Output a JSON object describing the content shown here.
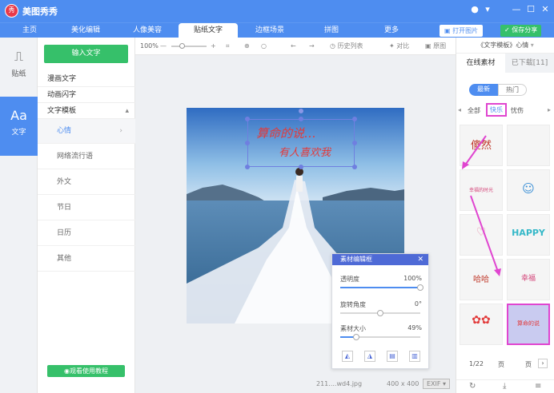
{
  "app": {
    "logo_glyph": "秀",
    "title": "美图秀秀"
  },
  "window": {
    "skin_icon": "chat-icon",
    "menu_icon": "dropdown-icon"
  },
  "nav": {
    "tabs": [
      "主页",
      "美化编辑",
      "人像美容",
      "贴纸文字",
      "边框场景",
      "拼图",
      "更多"
    ],
    "active_tab": "贴纸文字",
    "open_label": "打开图片",
    "save_label": "保存分享"
  },
  "iconbar": {
    "sticker_label": "贴纸",
    "text_label": "文字",
    "text_glyph": "Aa"
  },
  "categories": {
    "input_button": "输入文字",
    "head_items": [
      "漫画文字",
      "动画闪字",
      "文字模板"
    ],
    "sub_items": [
      "心情",
      "网络流行语",
      "外文",
      "节日",
      "日历",
      "其他"
    ],
    "active_sub": "心情",
    "tutorial_button": "观看使用教程"
  },
  "toolbar": {
    "zoom": "100%",
    "history": "历史列表",
    "compare": "对比",
    "original": "原图"
  },
  "canvas": {
    "sticker_line1": "算命的说…",
    "sticker_line2": "有人喜欢我"
  },
  "edit_panel": {
    "title": "素材编辑框",
    "opacity_label": "透明度",
    "opacity_value": "100%",
    "opacity_level": 1.0,
    "rotation_label": "旋转角度",
    "rotation_value": "0°",
    "rotation_level": 0.5,
    "size_label": "素材大小",
    "size_value": "49%",
    "size_level": 0.2
  },
  "status": {
    "filename": "211....wd4.jpg",
    "dimensions": "400 x 400",
    "exif": "EXIF"
  },
  "right_panel": {
    "title": "《文字模板》心情",
    "tab_online": "在线素材",
    "tab_downloaded": "已下载[11]",
    "toggle_new": "最新",
    "toggle_hot": "热门",
    "filters": [
      "全部",
      "快乐",
      "忧伤"
    ],
    "active_filter": "快乐",
    "cells": [
      "傻然",
      "",
      "幸福的时光",
      "",
      "",
      "HAPPY",
      "哈哈",
      "幸福",
      "",
      "算命的说"
    ],
    "page": "1/22",
    "page_suffix": "页"
  }
}
